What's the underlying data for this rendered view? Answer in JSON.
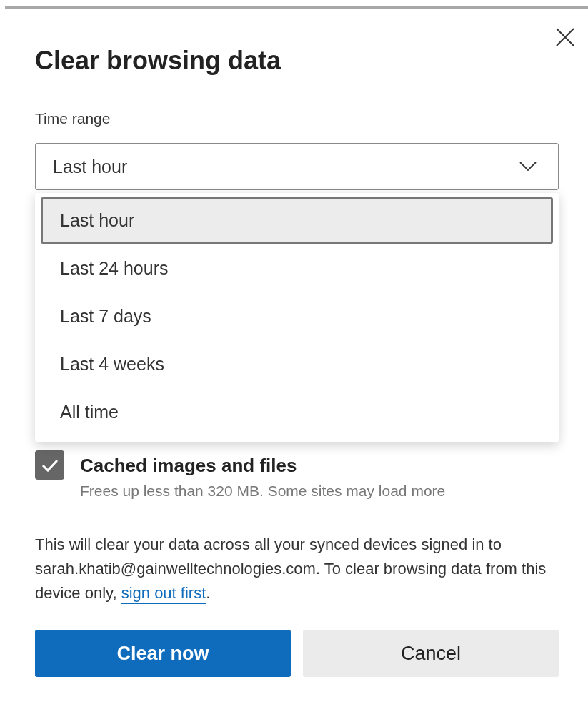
{
  "dialog": {
    "title": "Clear browsing data",
    "time_range": {
      "label": "Time range",
      "value": "Last hour",
      "expanded": true,
      "options": [
        {
          "label": "Last hour",
          "selected": true
        },
        {
          "label": "Last 24 hours",
          "selected": false
        },
        {
          "label": "Last 7 days",
          "selected": false
        },
        {
          "label": "Last 4 weeks",
          "selected": false
        },
        {
          "label": "All time",
          "selected": false
        }
      ]
    },
    "items": [
      {
        "label": "Cached images and files",
        "description": "Frees up less than 320 MB. Some sites may load more",
        "checked": true
      }
    ],
    "notice": {
      "text": "This will clear your data across all your synced devices signed in to sarah.khatib@gainwelltechnologies.com. To clear browsing data from this device only, ",
      "link": "sign out first",
      "end": "."
    },
    "buttons": [
      {
        "label": "Clear now",
        "kind": "primary"
      },
      {
        "label": "Cancel",
        "kind": "secondary"
      }
    ]
  }
}
